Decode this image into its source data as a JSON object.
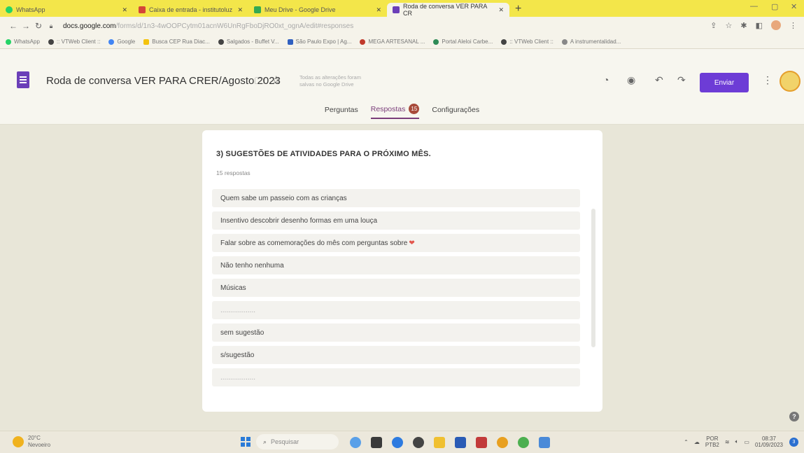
{
  "browser": {
    "tabs": [
      {
        "title": "WhatsApp",
        "color": "#25d366"
      },
      {
        "title": "Caixa de entrada - institutoluz",
        "color": "#d44638"
      },
      {
        "title": "Meu Drive - Google Drive",
        "color": "#34a853"
      },
      {
        "title": "Roda de conversa VER PARA CR",
        "color": "#6b3fb8"
      }
    ],
    "new_tab": "+",
    "url_host": "docs.google.com",
    "url_path": "/forms/d/1n3-4wOOPCytm01acnW6UnRgFboDjRO0xt_ognA/edit#responses",
    "bookmarks": [
      {
        "label": "WhatsApp",
        "color": "#25d366"
      },
      {
        "label": ":: VTWeb Client ::",
        "color": "#444444"
      },
      {
        "label": "Google",
        "color": "#4285f4"
      },
      {
        "label": "Busca CEP Rua Diac...",
        "color": "#f4c20d"
      },
      {
        "label": "Salgados - Buffet V...",
        "color": "#444444"
      },
      {
        "label": "São Paulo Expo | Ag...",
        "color": "#3060c0"
      },
      {
        "label": "MEGA ARTESANAL ...",
        "color": "#c0392b"
      },
      {
        "label": "Portal Aleloi Carbe...",
        "color": "#2e8b57"
      },
      {
        "label": ":: VTWeb Client ::",
        "color": "#444444"
      },
      {
        "label": "A instrumentalidad...",
        "color": "#888888"
      }
    ]
  },
  "form": {
    "title": "Roda de conversa VER PARA CRER/Agosto 2023",
    "saved_note": "Todas as alterações foram salvas no Google Drive",
    "send_label": "Enviar",
    "tabs": {
      "questions": "Perguntas",
      "responses": "Respostas",
      "responses_count": "15",
      "settings": "Configurações"
    }
  },
  "question": {
    "title": "3) SUGESTÕES DE ATIVIDADES PARA O PRÓXIMO MÊS.",
    "count_label": "15 respostas",
    "responses": [
      "Quem sabe um passeio com as crianças",
      "Insentivo descobrir desenho formas em uma louça",
      "Falar sobre as comemorações do mês com perguntas sobre",
      "Não tenho nenhuma",
      "Músicas",
      "..................",
      "sem sugestão",
      "s/sugestão",
      ".................."
    ]
  },
  "taskbar": {
    "weather_temp": "20°C",
    "weather_desc": "Nevoeiro",
    "search_placeholder": "Pesquisar",
    "lang1": "POR",
    "lang2": "PTB2",
    "time": "08:37",
    "date": "01/09/2023",
    "notif_count": "3"
  }
}
